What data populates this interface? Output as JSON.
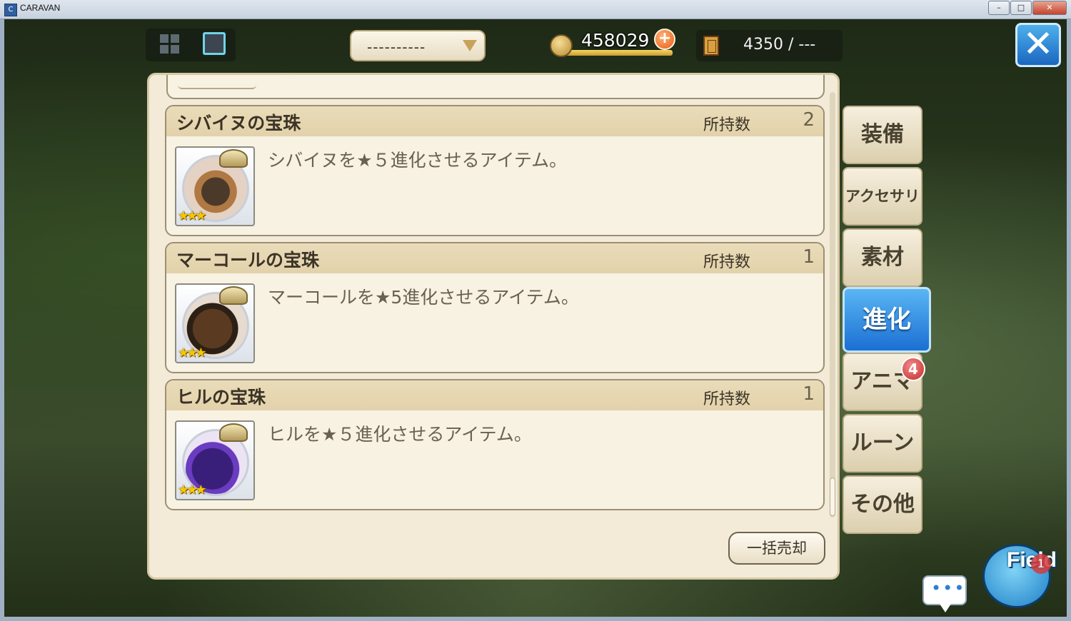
{
  "window": {
    "title": "CARAVAN",
    "buttons": [
      "–",
      "□",
      "✕"
    ]
  },
  "hud": {
    "view_modes": [
      "grid-view",
      "list-view"
    ],
    "filter_value": "----------",
    "gold": "458029",
    "gold_plus": "+",
    "capacity": "4350 / ---",
    "close": "✕"
  },
  "items": [
    {
      "name": "シバイヌの宝珠",
      "owned_label": "所持数",
      "count": "2",
      "stars": "★★★",
      "description": "シバイヌを★５進化させるアイテム。"
    },
    {
      "name": "マーコールの宝珠",
      "owned_label": "所持数",
      "count": "1",
      "stars": "★★★",
      "description": "マーコールを★5進化させるアイテム。"
    },
    {
      "name": "ヒルの宝珠",
      "owned_label": "所持数",
      "count": "1",
      "stars": "★★★",
      "description": "ヒルを★５進化させるアイテム。"
    }
  ],
  "bulk_sell": "一括売却",
  "tabs": {
    "equipment": "装備",
    "accessory": "アクセサリ",
    "material": "素材",
    "evolution": "進化",
    "anima": "アニマ",
    "anima_badge": "4",
    "rune": "ルーン",
    "other": "その他"
  },
  "chat": "•••",
  "field": {
    "label": "Field",
    "badge": "1"
  },
  "colors": {
    "active_tab": "#2a82dc",
    "panel_bg": "#f3ebd8",
    "item_header": "#e6d7b2",
    "gold_accent": "#e85d14"
  }
}
